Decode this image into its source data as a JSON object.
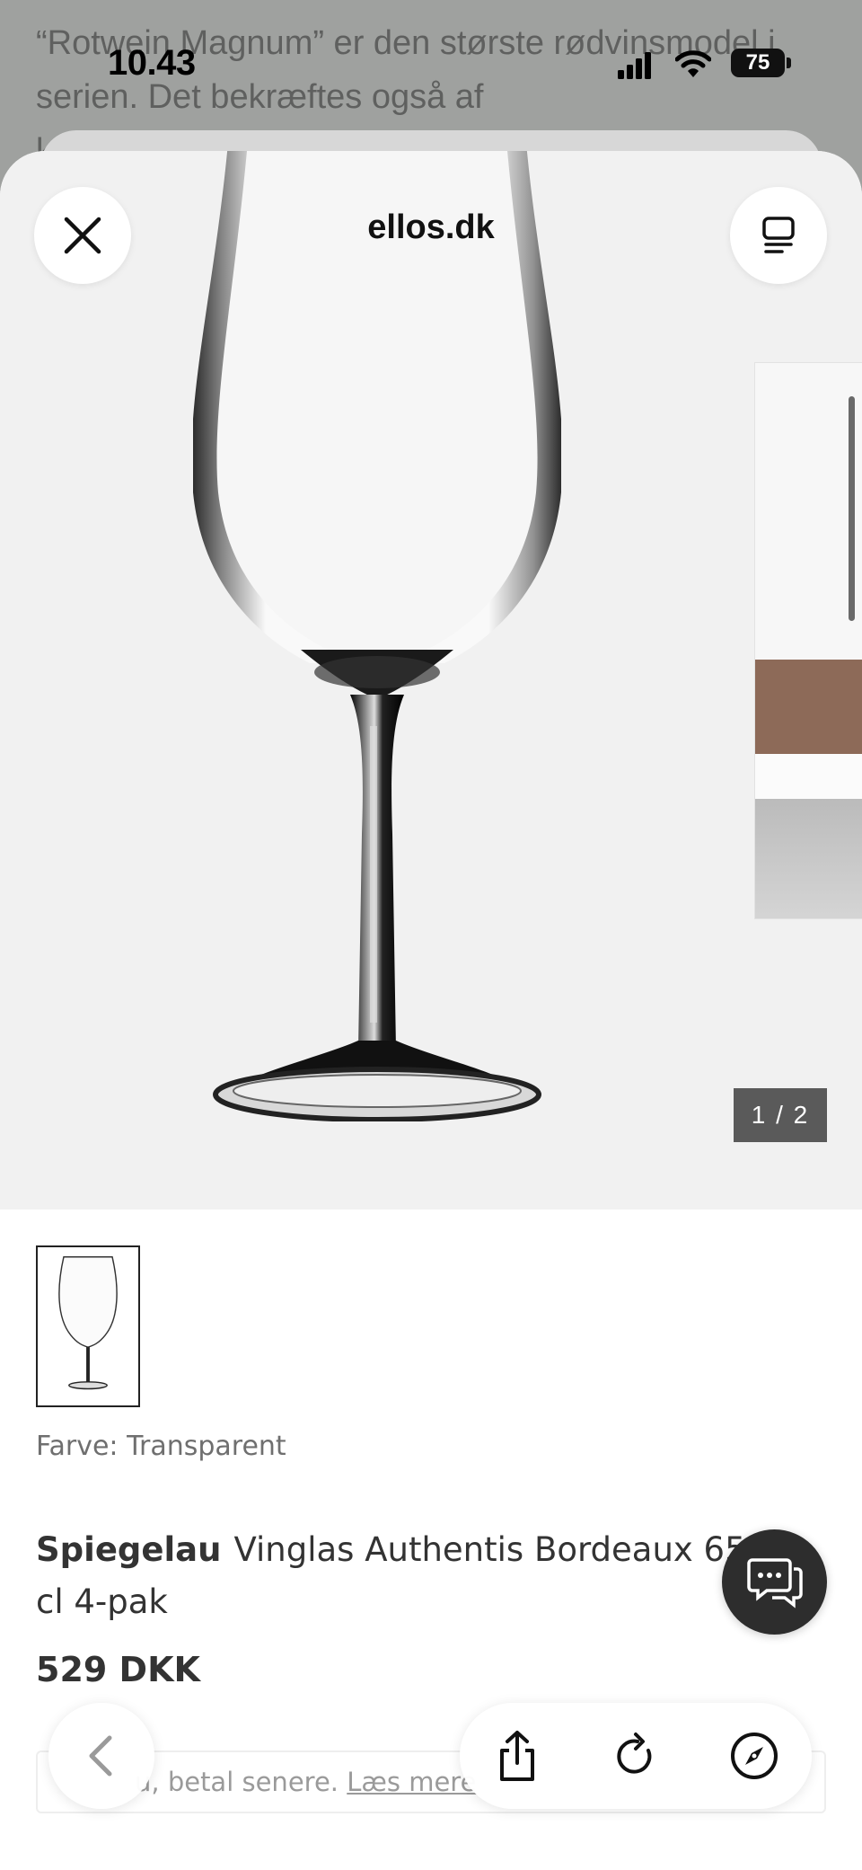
{
  "background_page": {
    "lines": [
      "“Rotwein Magnum” er den største rødvinsmodel i",
      "serien. Det bekræftes også af",
      "k"
    ]
  },
  "status_bar": {
    "time": "10.43",
    "battery": "75"
  },
  "header": {
    "site_title": "ellos.dk"
  },
  "gallery": {
    "counter": "1 / 2"
  },
  "product": {
    "color_label": "Farve: Transparent",
    "brand": "Spiegelau",
    "name": "Vinglas Authentis Bordeaux 65 cl 4-pak",
    "price": "529 DKK"
  },
  "promo": {
    "text": "u, betal senere.",
    "link": "Læs mere"
  },
  "icons": {
    "close": "close-icon",
    "reader": "reader-icon",
    "chat": "chat-icon",
    "back": "chevron-left-icon",
    "share": "share-icon",
    "reload": "reload-icon",
    "compass": "compass-icon"
  }
}
